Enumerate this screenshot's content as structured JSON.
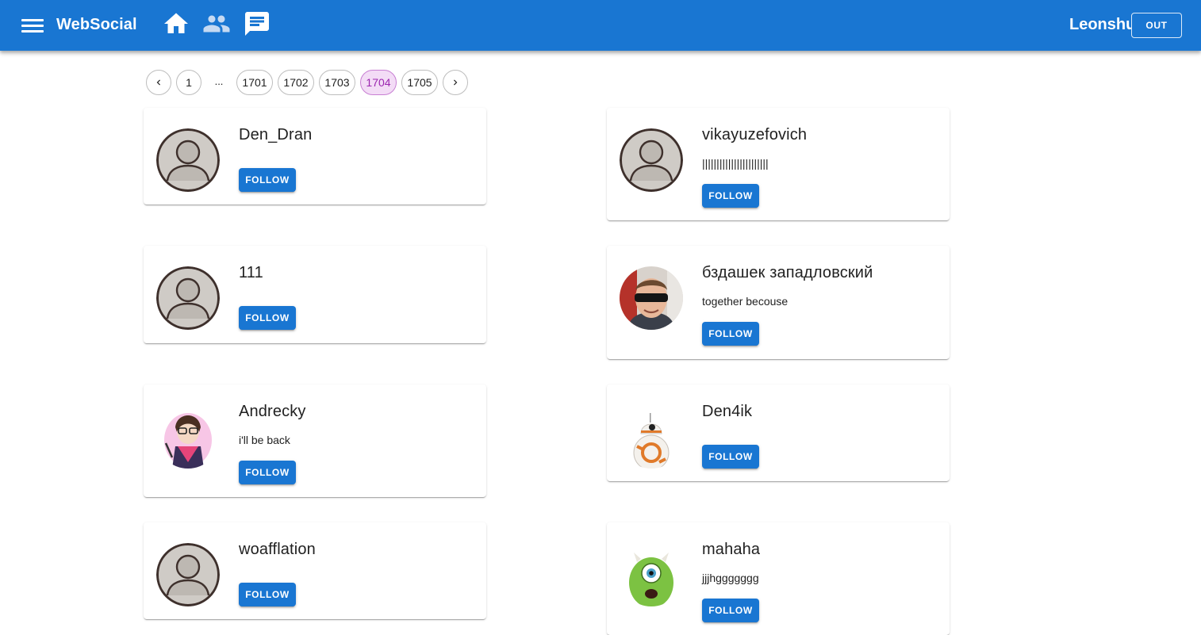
{
  "appbar": {
    "brand": "WebSocial",
    "username": "Leonshu",
    "logout_label": "OUT",
    "color": "#1976d2",
    "icons": [
      "menu-icon",
      "home-icon",
      "users-icon",
      "chat-icon"
    ]
  },
  "pagination": {
    "first": "1",
    "ellipsis": "...",
    "pages": [
      "1701",
      "1702",
      "1703",
      "1704",
      "1705"
    ],
    "current": "1704",
    "active_color": "#9c27b0"
  },
  "users": [
    {
      "name": "Den_Dran",
      "status": "",
      "avatar": "default",
      "follow_label": "FOLLOW"
    },
    {
      "name": "vikayuzefovich",
      "status": "|||||||||||||||||||||||",
      "avatar": "default",
      "follow_label": "FOLLOW"
    },
    {
      "name": "111",
      "status": "",
      "avatar": "default",
      "follow_label": "FOLLOW"
    },
    {
      "name": "бздашек западловский",
      "status": "together becouse",
      "avatar": "photo-man-sunglasses",
      "follow_label": "FOLLOW"
    },
    {
      "name": "Andrecky",
      "status": "i'll be back",
      "avatar": "cartoon-character",
      "follow_label": "FOLLOW"
    },
    {
      "name": "Den4ik",
      "status": "",
      "avatar": "bb8-droid",
      "follow_label": "FOLLOW"
    },
    {
      "name": "woafflation",
      "status": "",
      "avatar": "default",
      "follow_label": "FOLLOW"
    },
    {
      "name": "mahaha",
      "status": "jjjhggggggg",
      "avatar": "green-monster",
      "follow_label": "FOLLOW"
    }
  ]
}
